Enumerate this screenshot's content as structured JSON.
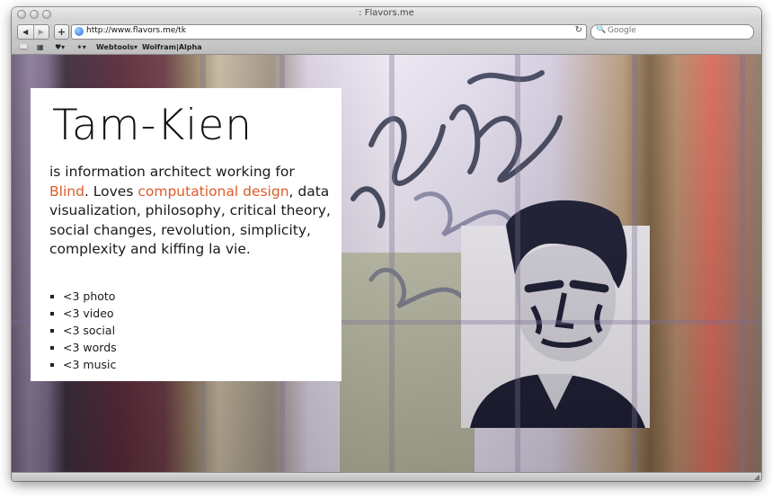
{
  "window": {
    "title": ": Flavors.me"
  },
  "toolbar": {
    "back_icon": "◀",
    "forward_icon": "▶",
    "add_icon": "+",
    "url": "http://www.flavors.me/tk",
    "reload_icon": "↻",
    "search_placeholder": "Google",
    "search_icon": "🔍"
  },
  "bookmarks": {
    "items": [
      {
        "label": "♥▾"
      },
      {
        "label": "✶▾"
      },
      {
        "label": "Webtools▾"
      },
      {
        "label": "Wolfram|Alpha"
      }
    ]
  },
  "profile": {
    "name": "Tam-Kien",
    "bio_prefix": "is information architect working for ",
    "link_company": "Blind",
    "bio_mid": ". Loves ",
    "link_interest": "computational design",
    "bio_suffix": ", data visualization, philosophy, critical theory, social changes, revolution, simplicity, complexity and kiffing la vie.",
    "loves": [
      "<3 photo",
      "<3 video",
      "<3 social",
      "<3 words",
      "<3 music"
    ]
  },
  "colors": {
    "link": "#e05a2b"
  }
}
